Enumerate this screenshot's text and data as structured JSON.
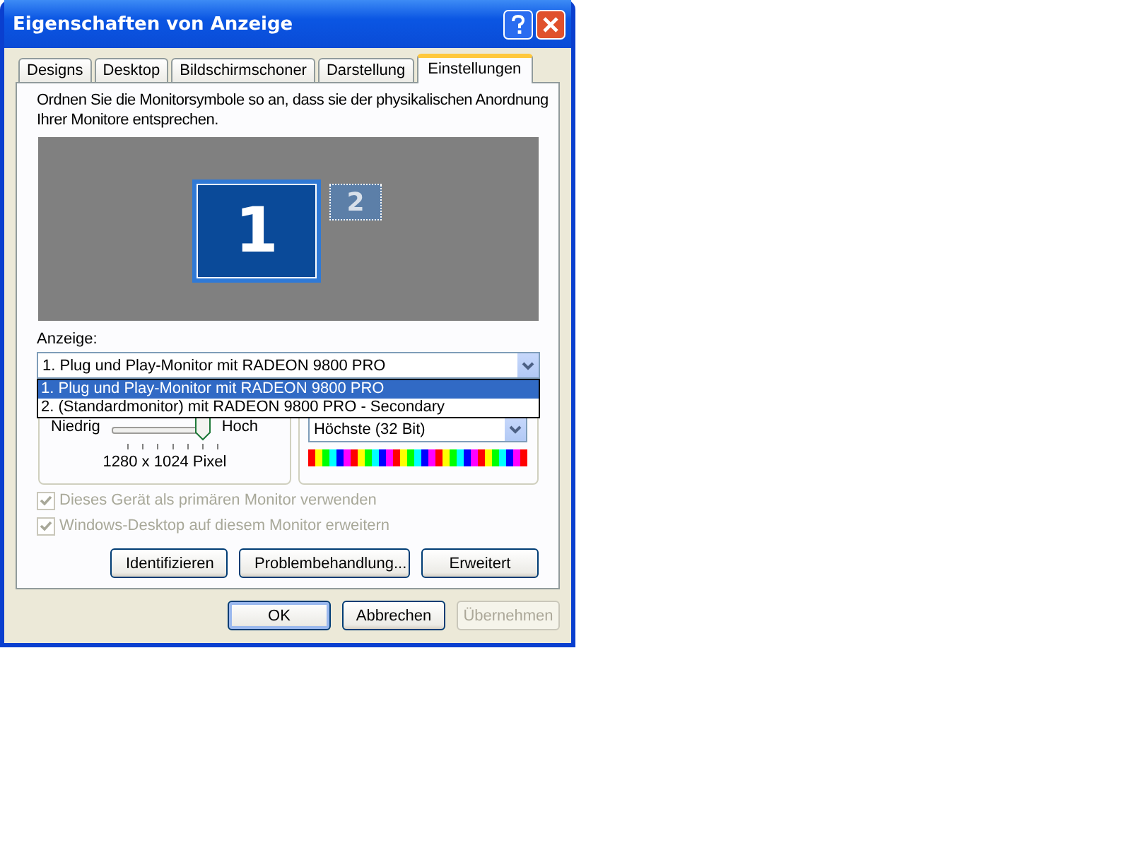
{
  "window": {
    "title": "Eigenschaften von Anzeige"
  },
  "tabs": [
    {
      "label": "Designs",
      "selected": false
    },
    {
      "label": "Desktop",
      "selected": false
    },
    {
      "label": "Bildschirmschoner",
      "selected": false
    },
    {
      "label": "Darstellung",
      "selected": false
    },
    {
      "label": "Einstellungen",
      "selected": true
    }
  ],
  "instructions": "Ordnen Sie die Monitorsymbole so an, dass sie der physikalischen Anordnung Ihrer Monitore entsprechen.",
  "monitors": [
    {
      "label": "1",
      "selected": true
    },
    {
      "label": "2",
      "selected": false
    }
  ],
  "display": {
    "label": "Anzeige:",
    "value": "1. Plug und Play-Monitor mit RADEON 9800 PRO",
    "options": [
      {
        "label": "1. Plug und Play-Monitor mit RADEON 9800 PRO",
        "selected": true
      },
      {
        "label": "2. (Standardmonitor) mit RADEON 9800 PRO - Secondary",
        "selected": false
      }
    ]
  },
  "resolution": {
    "low": "Niedrig",
    "high": "Hoch",
    "level": 1,
    "reading": "1280 x 1024 Pixel"
  },
  "color_quality": {
    "value": "Höchste (32 Bit)"
  },
  "checkboxes": [
    {
      "label": "Dieses Gerät als primären Monitor verwenden",
      "checked": true,
      "disabled": true
    },
    {
      "label": "Windows-Desktop auf diesem Monitor erweitern",
      "checked": true,
      "disabled": true
    }
  ],
  "panel_buttons": [
    "Identifizieren",
    "Problembehandlung...",
    "Erweitert"
  ],
  "dialog_buttons": [
    {
      "label": "OK",
      "disabled": false,
      "default": true
    },
    {
      "label": "Abbrechen",
      "disabled": false,
      "default": false
    },
    {
      "label": "Übernehmen",
      "disabled": true,
      "default": false
    }
  ]
}
